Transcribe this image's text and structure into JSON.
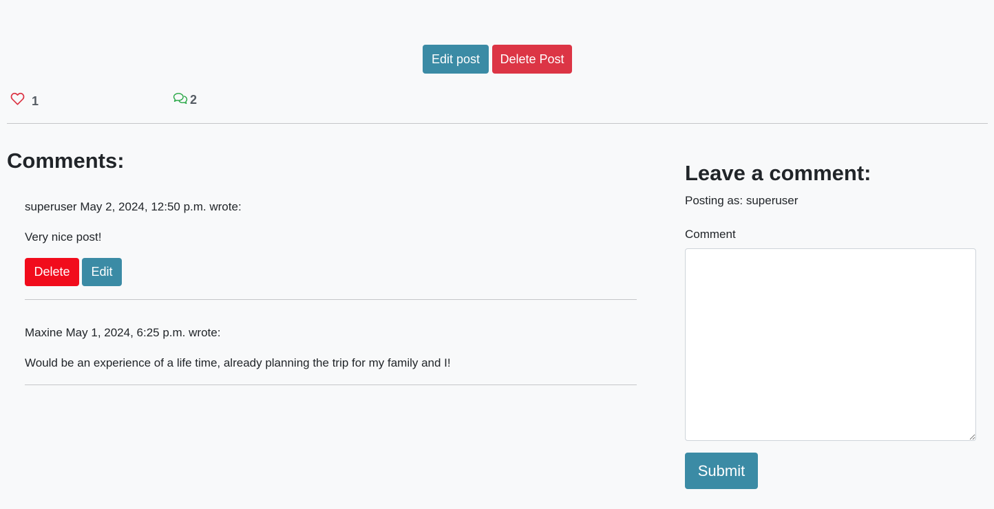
{
  "post_actions": {
    "edit_label": "Edit post",
    "delete_label": "Delete Post"
  },
  "stats": {
    "likes": "1",
    "comments": "2",
    "like_icon": "heart-outline-icon",
    "comment_icon": "chat-bubbles-icon",
    "like_color": "#dc3545",
    "comment_color": "#28a745"
  },
  "comments_section": {
    "heading": "Comments:",
    "items": [
      {
        "meta": "superuser May 2, 2024, 12:50 p.m. wrote:",
        "body": "Very nice post!",
        "delete_label": "Delete",
        "edit_label": "Edit"
      },
      {
        "meta": "Maxine May 1, 2024, 6:25 p.m. wrote:",
        "body": "Would be an experience of a life time, already planning the trip for my family and I!"
      }
    ]
  },
  "comment_form": {
    "heading": "Leave a comment:",
    "posting_as": "Posting as: superuser",
    "field_label": "Comment",
    "field_value": "",
    "submit_label": "Submit"
  },
  "colors": {
    "primary": "#3b8ba5",
    "danger": "#dc3545",
    "danger_bright": "#f10c1c",
    "background": "#f8f9fa"
  }
}
